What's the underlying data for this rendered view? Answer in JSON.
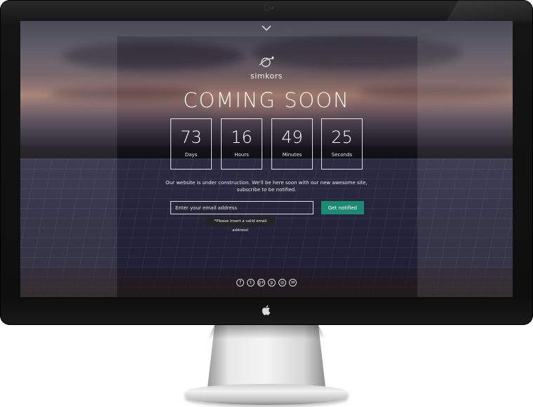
{
  "page": {
    "brand": "simkors",
    "headline": "COMING SOON"
  },
  "countdown": [
    {
      "value": "73",
      "label": "Days"
    },
    {
      "value": "16",
      "label": "Hours"
    },
    {
      "value": "49",
      "label": "Minutes"
    },
    {
      "value": "25",
      "label": "Seconds"
    }
  ],
  "description": {
    "line1": "Our website is under construction. We'll be here soon with our new awesome site,",
    "line2": "subscribe to be notified."
  },
  "subscribe": {
    "placeholder": "Enter your email address",
    "value": "",
    "button_label": "Get notified",
    "error": "*Please insert a valid email address!"
  },
  "social": [
    {
      "icon": "facebook-icon",
      "glyph": "f"
    },
    {
      "icon": "twitter-icon",
      "glyph": "t"
    },
    {
      "icon": "google-plus-icon",
      "glyph": "g+"
    },
    {
      "icon": "pinterest-icon",
      "glyph": "p"
    },
    {
      "icon": "instagram-icon",
      "glyph": "◎"
    },
    {
      "icon": "email-icon",
      "glyph": "✉"
    }
  ],
  "colors": {
    "accent": "#1f8a73",
    "text": "#ffffff",
    "monitor_bezel": "#141414"
  }
}
